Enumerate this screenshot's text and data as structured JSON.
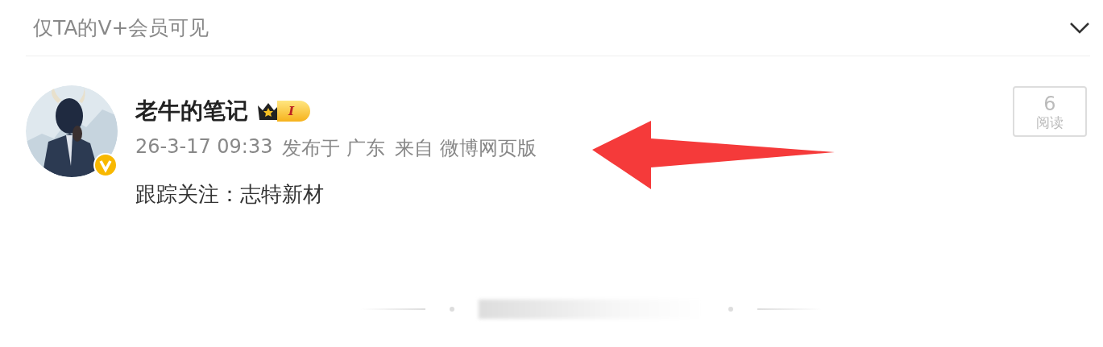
{
  "header": {
    "title": "仅TA的V+会员可见"
  },
  "post": {
    "author": "老牛的笔记",
    "vip_level": "I",
    "time": "26-3-17 09:33",
    "location": "发布于 广东",
    "source": "来自 微博网页版",
    "text": "跟踪关注：志特新材",
    "reads": {
      "count": "6",
      "label": "阅读"
    }
  }
}
